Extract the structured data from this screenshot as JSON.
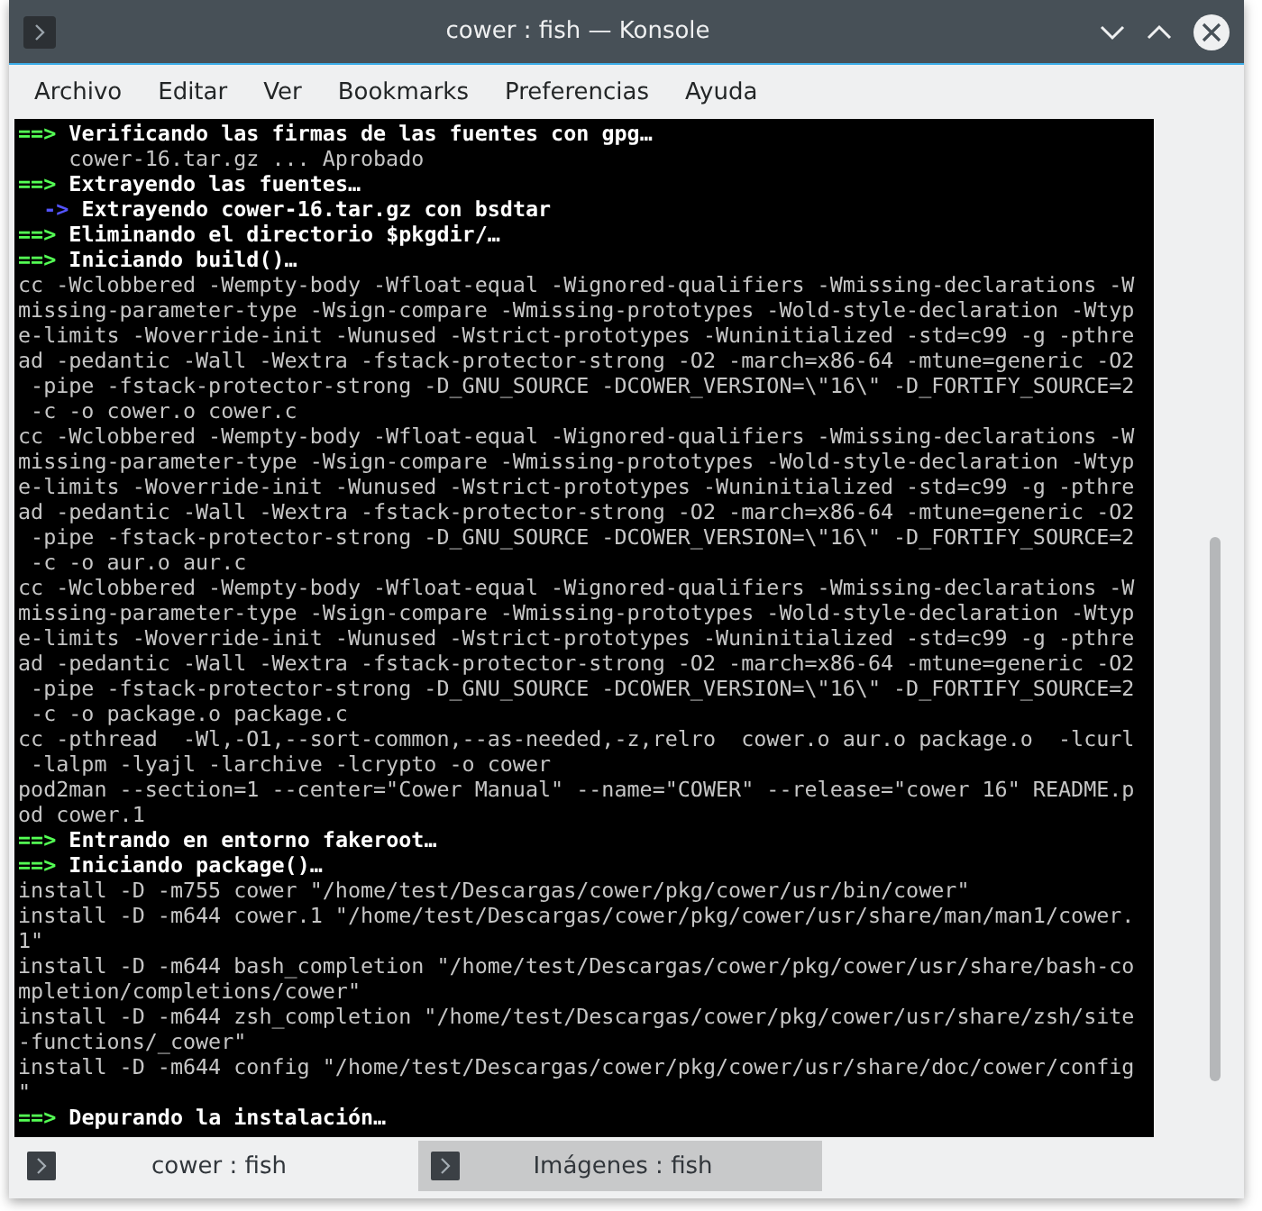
{
  "window": {
    "title": "cower : fish — Konsole"
  },
  "menu": [
    "Archivo",
    "Editar",
    "Ver",
    "Bookmarks",
    "Preferencias",
    "Ayuda"
  ],
  "terminal": {
    "lines": [
      {
        "kind": "step",
        "marker": "==>",
        "text": "Verificando las firmas de las fuentes con gpg…"
      },
      {
        "kind": "output",
        "text": "    cower-16.tar.gz ... Aprobado"
      },
      {
        "kind": "step",
        "marker": "==>",
        "text": "Extrayendo las fuentes…"
      },
      {
        "kind": "substep",
        "marker": "  ->",
        "text": "Extrayendo cower-16.tar.gz con bsdtar"
      },
      {
        "kind": "step",
        "marker": "==>",
        "text": "Eliminando el directorio $pkgdir/…"
      },
      {
        "kind": "step",
        "marker": "==>",
        "text": "Iniciando build()…"
      },
      {
        "kind": "output",
        "text": "cc -Wclobbered -Wempty-body -Wfloat-equal -Wignored-qualifiers -Wmissing-declarations -W"
      },
      {
        "kind": "output",
        "text": "missing-parameter-type -Wsign-compare -Wmissing-prototypes -Wold-style-declaration -Wtyp"
      },
      {
        "kind": "output",
        "text": "e-limits -Woverride-init -Wunused -Wstrict-prototypes -Wuninitialized -std=c99 -g -pthre"
      },
      {
        "kind": "output",
        "text": "ad -pedantic -Wall -Wextra -fstack-protector-strong -O2 -march=x86-64 -mtune=generic -O2"
      },
      {
        "kind": "output",
        "text": " -pipe -fstack-protector-strong -D_GNU_SOURCE -DCOWER_VERSION=\\\"16\\\" -D_FORTIFY_SOURCE=2"
      },
      {
        "kind": "output",
        "text": " -c -o cower.o cower.c"
      },
      {
        "kind": "output",
        "text": "cc -Wclobbered -Wempty-body -Wfloat-equal -Wignored-qualifiers -Wmissing-declarations -W"
      },
      {
        "kind": "output",
        "text": "missing-parameter-type -Wsign-compare -Wmissing-prototypes -Wold-style-declaration -Wtyp"
      },
      {
        "kind": "output",
        "text": "e-limits -Woverride-init -Wunused -Wstrict-prototypes -Wuninitialized -std=c99 -g -pthre"
      },
      {
        "kind": "output",
        "text": "ad -pedantic -Wall -Wextra -fstack-protector-strong -O2 -march=x86-64 -mtune=generic -O2"
      },
      {
        "kind": "output",
        "text": " -pipe -fstack-protector-strong -D_GNU_SOURCE -DCOWER_VERSION=\\\"16\\\" -D_FORTIFY_SOURCE=2"
      },
      {
        "kind": "output",
        "text": " -c -o aur.o aur.c"
      },
      {
        "kind": "output",
        "text": "cc -Wclobbered -Wempty-body -Wfloat-equal -Wignored-qualifiers -Wmissing-declarations -W"
      },
      {
        "kind": "output",
        "text": "missing-parameter-type -Wsign-compare -Wmissing-prototypes -Wold-style-declaration -Wtyp"
      },
      {
        "kind": "output",
        "text": "e-limits -Woverride-init -Wunused -Wstrict-prototypes -Wuninitialized -std=c99 -g -pthre"
      },
      {
        "kind": "output",
        "text": "ad -pedantic -Wall -Wextra -fstack-protector-strong -O2 -march=x86-64 -mtune=generic -O2"
      },
      {
        "kind": "output",
        "text": " -pipe -fstack-protector-strong -D_GNU_SOURCE -DCOWER_VERSION=\\\"16\\\" -D_FORTIFY_SOURCE=2"
      },
      {
        "kind": "output",
        "text": " -c -o package.o package.c"
      },
      {
        "kind": "output",
        "text": "cc -pthread  -Wl,-O1,--sort-common,--as-needed,-z,relro  cower.o aur.o package.o  -lcurl"
      },
      {
        "kind": "output",
        "text": " -lalpm -lyajl -larchive -lcrypto -o cower"
      },
      {
        "kind": "output",
        "text": "pod2man --section=1 --center=\"Cower Manual\" --name=\"COWER\" --release=\"cower 16\" README.p"
      },
      {
        "kind": "output",
        "text": "od cower.1"
      },
      {
        "kind": "step",
        "marker": "==>",
        "text": "Entrando en entorno fakeroot…"
      },
      {
        "kind": "step",
        "marker": "==>",
        "text": "Iniciando package()…"
      },
      {
        "kind": "output",
        "text": "install -D -m755 cower \"/home/test/Descargas/cower/pkg/cower/usr/bin/cower\""
      },
      {
        "kind": "output",
        "text": "install -D -m644 cower.1 \"/home/test/Descargas/cower/pkg/cower/usr/share/man/man1/cower."
      },
      {
        "kind": "output",
        "text": "1\""
      },
      {
        "kind": "output",
        "text": "install -D -m644 bash_completion \"/home/test/Descargas/cower/pkg/cower/usr/share/bash-co"
      },
      {
        "kind": "output",
        "text": "mpletion/completions/cower\""
      },
      {
        "kind": "output",
        "text": "install -D -m644 zsh_completion \"/home/test/Descargas/cower/pkg/cower/usr/share/zsh/site"
      },
      {
        "kind": "output",
        "text": "-functions/_cower\""
      },
      {
        "kind": "output",
        "text": "install -D -m644 config \"/home/test/Descargas/cower/pkg/cower/usr/share/doc/cower/config"
      },
      {
        "kind": "output",
        "text": "\""
      },
      {
        "kind": "step",
        "marker": "==>",
        "text": "Depurando la instalación…"
      }
    ]
  },
  "tabs": [
    {
      "label": "cower : fish",
      "selected": true
    },
    {
      "label": "Imágenes : fish",
      "selected": false
    }
  ]
}
